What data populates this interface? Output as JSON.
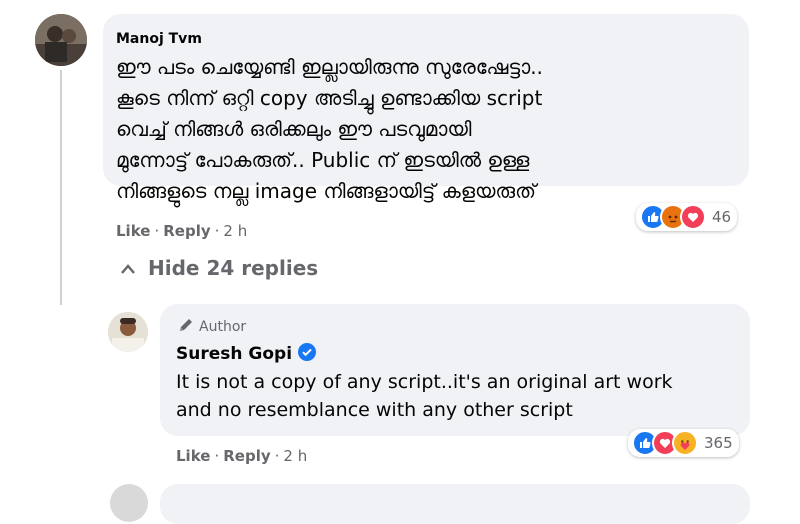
{
  "comment": {
    "author": "Manoj Tvm",
    "lines": [
      "ഈ പടം ചെയ്യേണ്ടി ഇല്ലായിരുന്നു സുരേഷേട്ടാ..",
      "കൂടെ നിന്ന് ഒറ്റി copy അടിച്ചു ഉണ്ടാക്കിയ script",
      "വെച്ച് നിങ്ങൾ ഒരിക്കലും ഈ പടവുമായി",
      "മുന്നോട്ട് പോകരുത്.. Public ന് ഇടയിൽ ഉള്ള",
      "നിങ്ങളുടെ നല്ല image നിങ്ങളായിട്ട് കളയരുത്"
    ],
    "reaction_count": "46",
    "like_label": "Like",
    "reply_label": "Reply",
    "time": "2 h"
  },
  "hide_replies_label": "Hide 24 replies",
  "reply": {
    "badge": "Author",
    "author": "Suresh Gopi",
    "lines": [
      "It is not a copy of any script..it's an original art work",
      "and no resemblance with any other script"
    ],
    "reaction_count": "365",
    "like_label": "Like",
    "reply_label": "Reply",
    "time": "2 h"
  },
  "colors": {
    "bubble": "#f0f2f5",
    "secondary_text": "#65676b",
    "verified": "#1877f2",
    "like": "#1877f2",
    "love": "#f33e58",
    "angry": "#e9710f",
    "care": "#f7b125"
  }
}
